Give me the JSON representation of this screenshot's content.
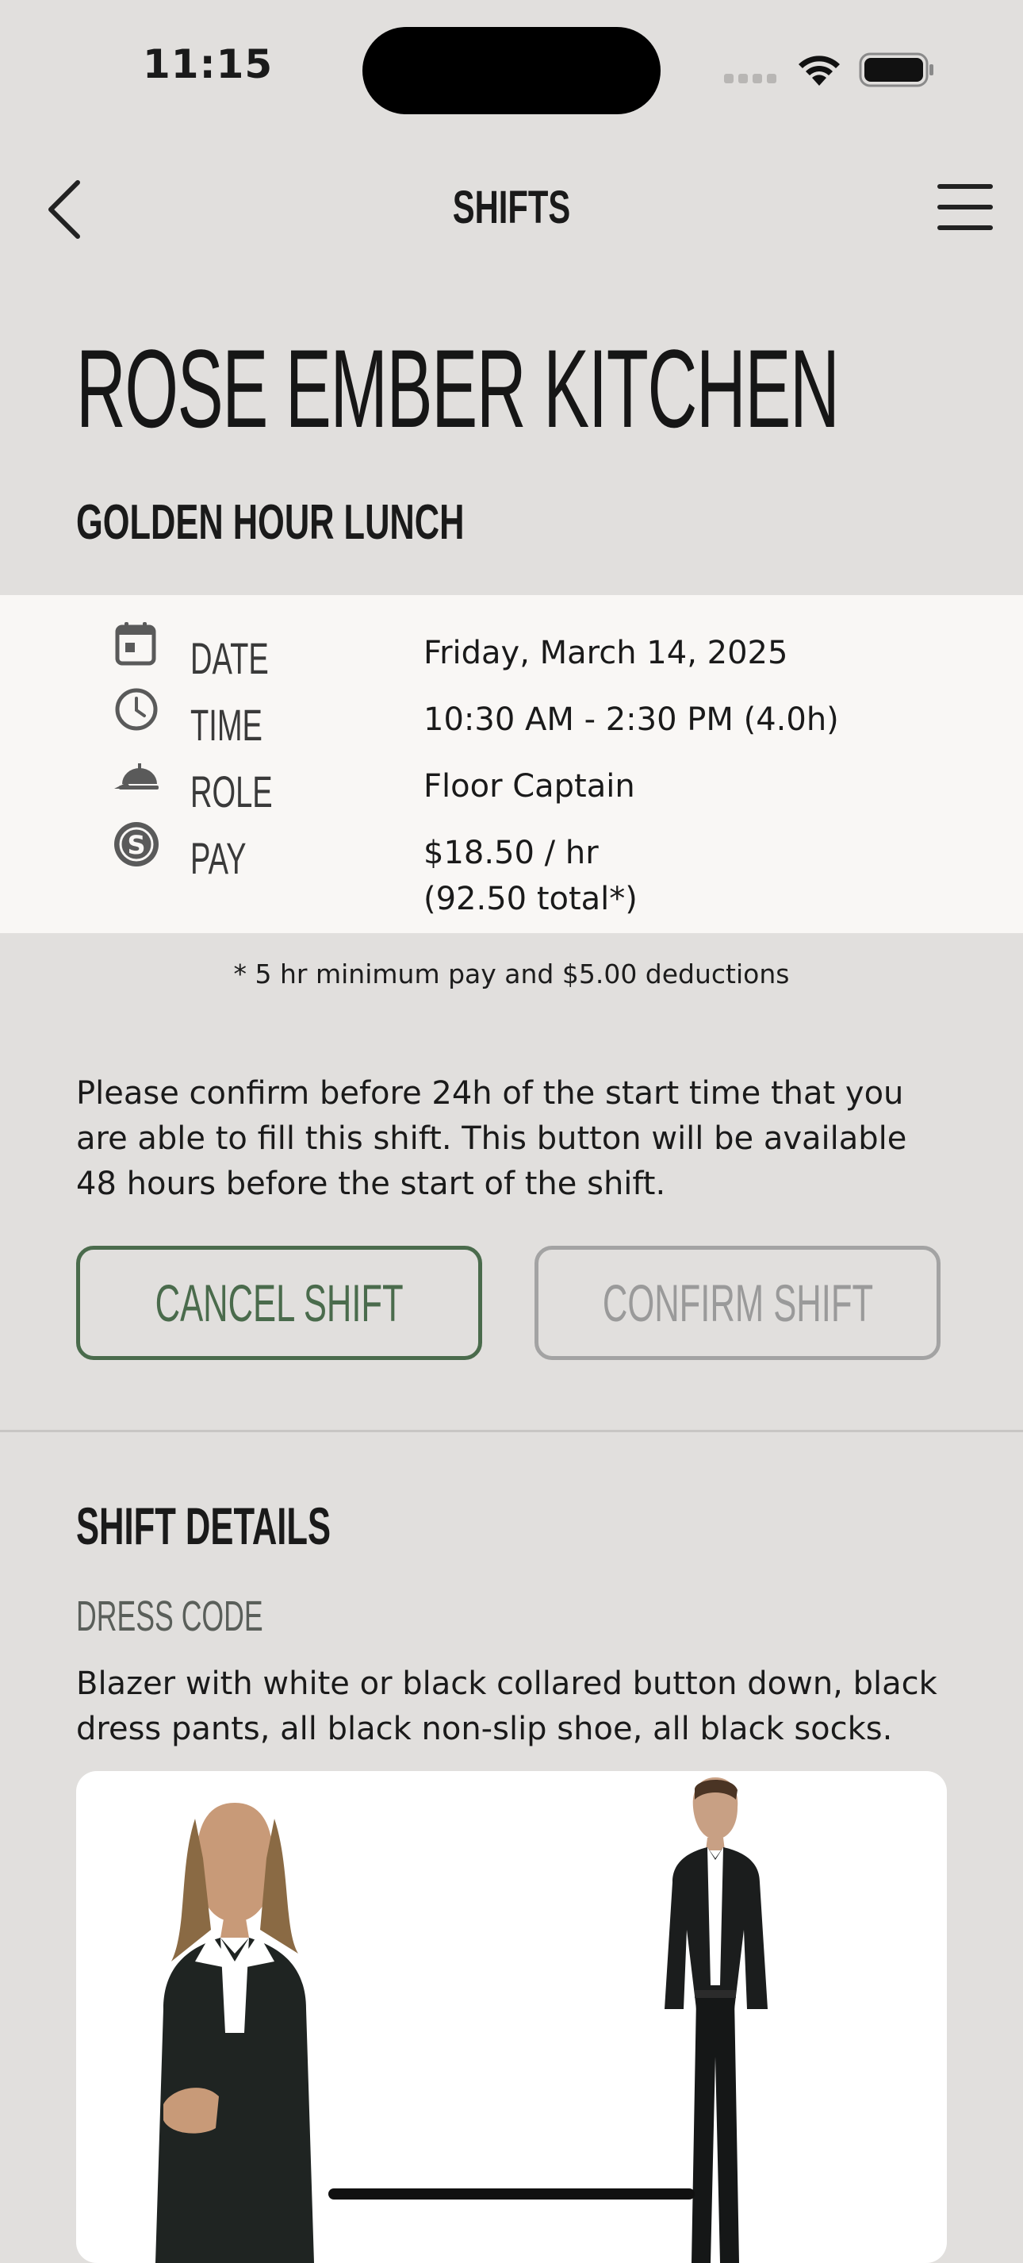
{
  "status_bar": {
    "time": "11:15",
    "signal_icon": "signal-dots-icon",
    "wifi_icon": "wifi-icon",
    "battery_icon": "battery-full-icon"
  },
  "nav": {
    "title": "SHIFTS",
    "back_icon": "chevron-left-icon",
    "menu_icon": "hamburger-menu-icon"
  },
  "restaurant_name": "ROSE EMBER KITCHEN",
  "shift_name": "GOLDEN HOUR LUNCH",
  "info": {
    "date": {
      "icon": "calendar-icon",
      "label": "DATE",
      "value": "Friday, March 14, 2025"
    },
    "time": {
      "icon": "clock-icon",
      "label": "TIME",
      "value": "10:30 AM - 2:30 PM (4.0h)"
    },
    "role": {
      "icon": "service-bell-icon",
      "label": "ROLE",
      "value": "Floor Captain"
    },
    "pay": {
      "icon": "dollar-coin-icon",
      "label": "PAY",
      "value_line1": "$18.50 / hr",
      "value_line2": "(92.50 total*)"
    }
  },
  "footnote": "* 5 hr minimum pay and $5.00 deductions",
  "confirm_note": "Please confirm before 24h of the start time that you are able to fill this shift. This button will be available 48 hours before the start of the shift.",
  "buttons": {
    "cancel": "CANCEL SHIFT",
    "confirm": "CONFIRM SHIFT"
  },
  "details": {
    "title": "SHIFT DETAILS",
    "dress_code_title": "DRESS CODE",
    "dress_code_text": "Blazer with white or black collared button down, black dress pants, all black non-slip shoe, all black socks."
  },
  "colors": {
    "background": "#e1dfdd",
    "panel": "#f9f7f5",
    "accent_green": "#4a6b4c",
    "disabled_gray": "#a3a3a3"
  }
}
